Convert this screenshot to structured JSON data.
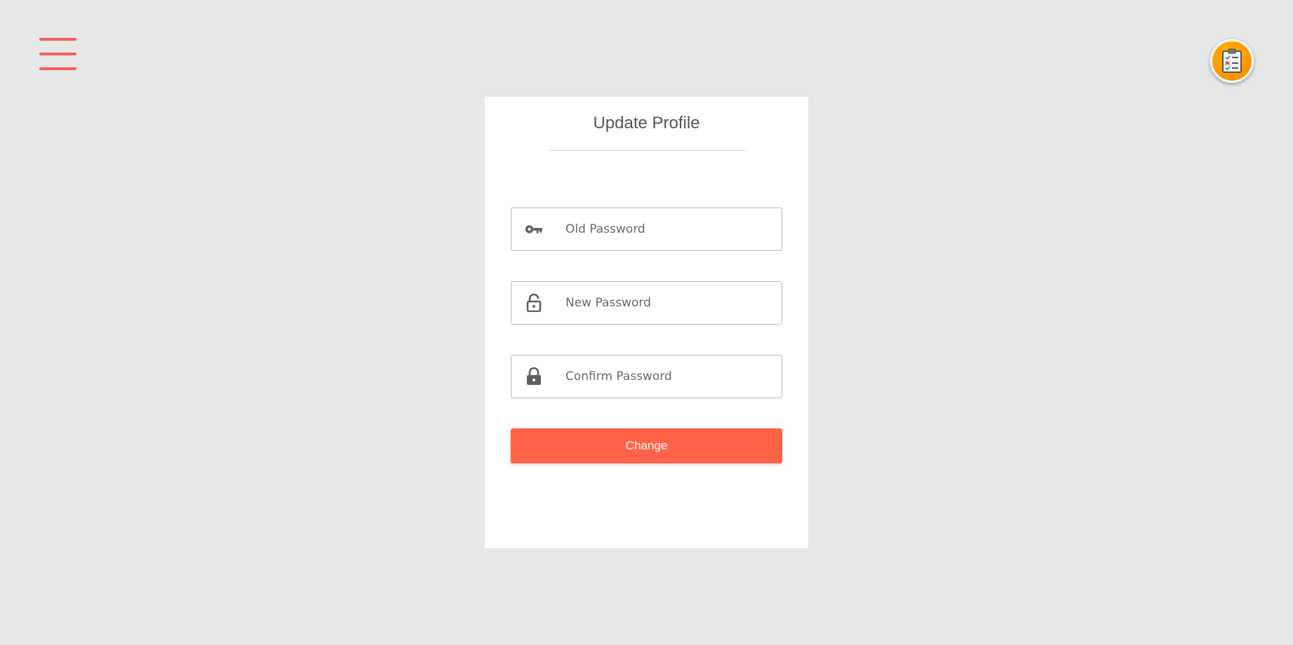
{
  "card": {
    "title": "Update Profile"
  },
  "form": {
    "old_password": {
      "placeholder": "Old Password",
      "value": "",
      "icon": "key-icon"
    },
    "new_password": {
      "placeholder": "New Password",
      "value": "",
      "icon": "unlocked-padlock-icon"
    },
    "confirm_password": {
      "placeholder": "Confirm Password",
      "value": "",
      "icon": "locked-padlock-icon"
    },
    "submit_label": "Change"
  },
  "icons": {
    "menu": "hamburger-menu-icon",
    "checklist": "clipboard-checklist-icon"
  },
  "colors": {
    "background": "#e7e7e7",
    "card": "#ffffff",
    "accent": "#ff6347",
    "menu_bars": "#f4605a",
    "fab": "#ff9a00",
    "icon_gray": "#5f5f5f"
  }
}
